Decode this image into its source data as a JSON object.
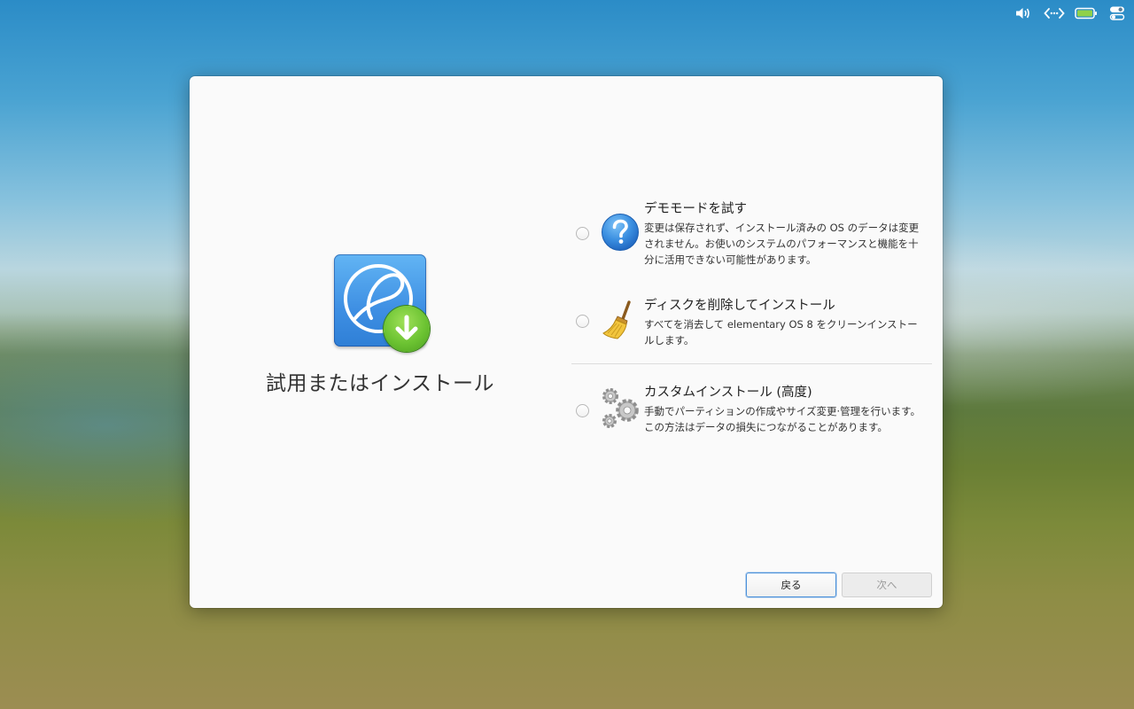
{
  "panel": {
    "indicators": [
      "volume-icon",
      "network-icon",
      "battery-icon",
      "session-toggle-icon"
    ]
  },
  "installer": {
    "title": "試用またはインストール",
    "options": [
      {
        "icon": "help-question-icon",
        "title": "デモモードを試す",
        "description": "変更は保存されず、インストール済みの OS のデータは変更されません。お使いのシステムのパフォーマンスと機能を十分に活用できない可能性があります。"
      },
      {
        "icon": "broom-icon",
        "title": "ディスクを削除してインストール",
        "description": "すべてを消去して elementary OS 8 をクリーンインストールします。"
      },
      {
        "icon": "gears-icon",
        "title": "カスタムインストール (高度)",
        "description": "手動でパーティションの作成やサイズ変更·管理を行います。この方法はデータの損失につながることがあります。"
      }
    ],
    "buttons": {
      "back": "戻る",
      "next": "次へ"
    }
  },
  "colors": {
    "focus_blue": "#4a90d9",
    "installer_blue": "#3e8fe3",
    "download_green": "#6cc332"
  }
}
